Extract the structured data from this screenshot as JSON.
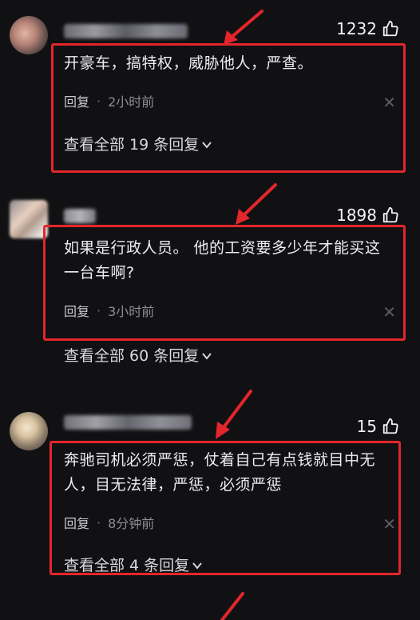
{
  "comments": [
    {
      "likes": "1232",
      "text": "开豪车，搞特权，威胁他人，严查。",
      "reply_label": "回复",
      "time": "2小时前",
      "view_all": "查看全部 19 条回复"
    },
    {
      "likes": "1898",
      "text": "如果是行政人员。 他的工资要多少年才能买这一台车啊?",
      "reply_label": "回复",
      "time": "3小时前",
      "view_all": "查看全部 60 条回复"
    },
    {
      "likes": "15",
      "text": "奔驰司机必须严惩，仗着自己有点钱就目中无人，目无法律，严惩，必须严惩",
      "reply_label": "回复",
      "time": "8分钟前",
      "view_all": "查看全部 4 条回复"
    }
  ],
  "separator": "·",
  "close_glyph": "✕",
  "colors": {
    "highlight": "#e3262b",
    "background": "#111113"
  },
  "icons": [
    "thumbs-up-icon",
    "close-icon",
    "chevron-down-icon",
    "red-arrow-icon"
  ]
}
